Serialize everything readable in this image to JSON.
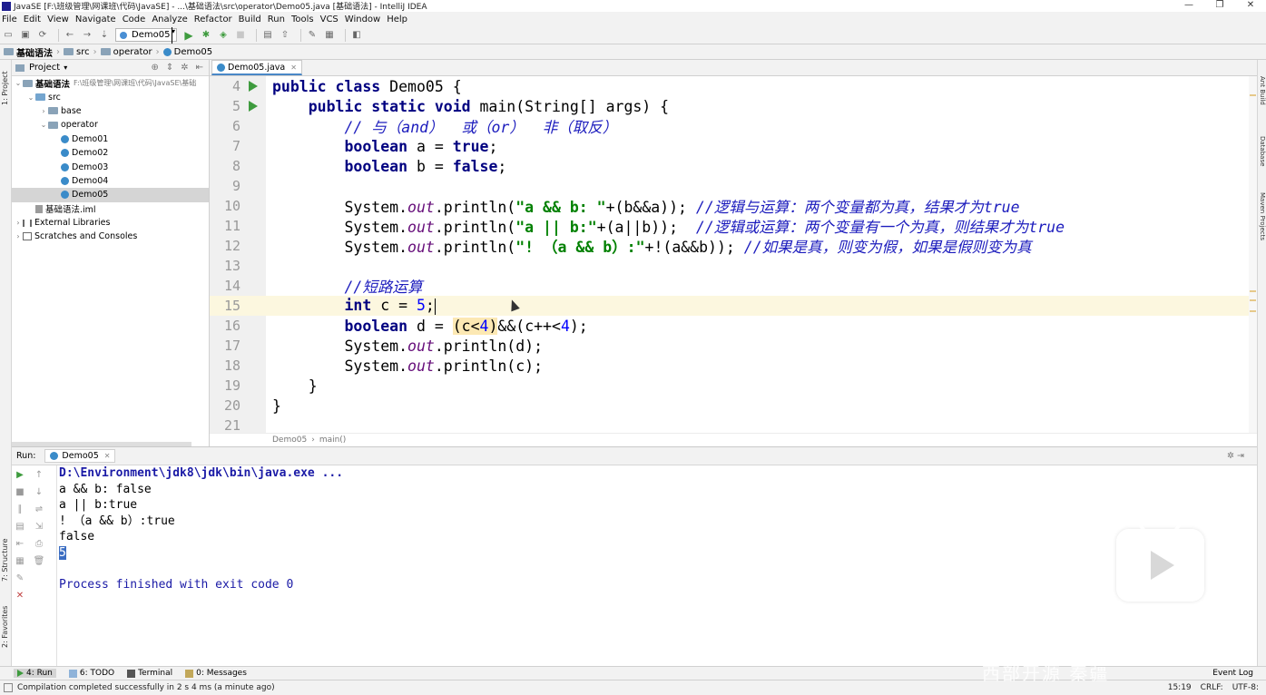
{
  "window": {
    "title": "JavaSE [F:\\班级管理\\网课班\\代码\\JavaSE] - ...\\基础语法\\src\\operator\\Demo05.java [基础语法] - IntelliJ IDEA",
    "minimize": "—",
    "maximize": "❐",
    "close": "✕"
  },
  "menu": [
    "File",
    "Edit",
    "View",
    "Navigate",
    "Code",
    "Analyze",
    "Refactor",
    "Build",
    "Run",
    "Tools",
    "VCS",
    "Window",
    "Help"
  ],
  "toolbar": {
    "run_config": "Demo05"
  },
  "breadcrumb": [
    "基础语法",
    "src",
    "operator",
    "Demo05"
  ],
  "left_strip": {
    "project_label": "1: Project",
    "structure_label": "7: Structure",
    "favorites_label": "2: Favorites"
  },
  "right_strip": {
    "ant_label": "Ant Build",
    "database_label": "Database",
    "maven_label": "Maven Projects"
  },
  "project_panel": {
    "header": "Project",
    "tree": [
      {
        "label": "基础语法",
        "path": "F:\\班级管理\\网课班\\代码\\JavaSE\\基础",
        "indent": 0,
        "arrow": "⌄",
        "icon": "folder"
      },
      {
        "label": "src",
        "indent": 1,
        "arrow": "⌄",
        "icon": "folder-blue"
      },
      {
        "label": "base",
        "indent": 2,
        "arrow": "›",
        "icon": "folder"
      },
      {
        "label": "operator",
        "indent": 2,
        "arrow": "⌄",
        "icon": "folder"
      },
      {
        "label": "Demo01",
        "indent": 3,
        "arrow": "",
        "icon": "class"
      },
      {
        "label": "Demo02",
        "indent": 3,
        "arrow": "",
        "icon": "class"
      },
      {
        "label": "Demo03",
        "indent": 3,
        "arrow": "",
        "icon": "class"
      },
      {
        "label": "Demo04",
        "indent": 3,
        "arrow": "",
        "icon": "class"
      },
      {
        "label": "Demo05",
        "indent": 3,
        "arrow": "",
        "icon": "class",
        "selected": true
      },
      {
        "label": "基础语法.iml",
        "indent": 1,
        "arrow": "",
        "icon": "iml"
      },
      {
        "label": "External Libraries",
        "indent": 0,
        "arrow": "›",
        "icon": "lib"
      },
      {
        "label": "Scratches and Consoles",
        "indent": 0,
        "arrow": "›",
        "icon": "scratch"
      }
    ]
  },
  "editor": {
    "tab": "Demo05.java",
    "footer": [
      "Demo05",
      "main()"
    ],
    "lines": [
      {
        "n": "4",
        "run": true,
        "html": "<span class='kw'>public class</span> Demo05 {"
      },
      {
        "n": "5",
        "run": true,
        "html": "    <span class='kw'>public static void</span> main(String[] args) {"
      },
      {
        "n": "6",
        "html": "        <span class='cmz'>// 与（and）  或（or）  非（取反）</span>"
      },
      {
        "n": "7",
        "html": "        <span class='kw'>boolean</span> a = <span class='kw'>true</span>;"
      },
      {
        "n": "8",
        "html": "        <span class='kw'>boolean</span> b = <span class='kw'>false</span>;"
      },
      {
        "n": "9",
        "html": ""
      },
      {
        "n": "10",
        "html": "        System.<span class='fld'>out</span>.println(<span class='str'>\"a &amp;&amp; b: \"</span>+(b&amp;&amp;a)); <span class='cmz'>//逻辑与运算：两个变量都为真，结果才为true</span>"
      },
      {
        "n": "11",
        "html": "        System.<span class='fld'>out</span>.println(<span class='str'>\"a || b:\"</span>+(a||b));  <span class='cmz'>//逻辑或运算：两个变量有一个为真，则结果才为true</span>"
      },
      {
        "n": "12",
        "html": "        System.<span class='fld'>out</span>.println(<span class='str'>\"! （a &amp;&amp; b）:\"</span>+!(a&amp;&amp;b)); <span class='cmz'>//如果是真，则变为假，如果是假则变为真</span>"
      },
      {
        "n": "13",
        "html": ""
      },
      {
        "n": "14",
        "html": "        <span class='cmz'>//短路运算</span>"
      },
      {
        "n": "15",
        "cur": true,
        "html": "        <span class='kw'>int</span> c = <span class='num'>5</span>;<span class='caret'></span>"
      },
      {
        "n": "16",
        "html": "        <span class='kw'>boolean</span> d = <span class='hl'>(c&lt;<span class='num'>4</span>)</span>&amp;&amp;(c++&lt;<span class='num'>4</span>);"
      },
      {
        "n": "17",
        "html": "        System.<span class='fld'>out</span>.println(d);"
      },
      {
        "n": "18",
        "html": "        System.<span class='fld'>out</span>.println(c);"
      },
      {
        "n": "19",
        "html": "    }"
      },
      {
        "n": "20",
        "html": "}"
      },
      {
        "n": "21",
        "html": ""
      }
    ]
  },
  "run_panel": {
    "label": "Run:",
    "tab": "Demo05",
    "console": [
      {
        "text": "D:\\Environment\\jdk8\\jdk\\bin\\java.exe ...",
        "cls": "path"
      },
      {
        "text": "a && b: false",
        "cls": ""
      },
      {
        "text": "a || b:true",
        "cls": ""
      },
      {
        "text": "! （a && b）:true",
        "cls": ""
      },
      {
        "text": "false",
        "cls": ""
      },
      {
        "text": "5",
        "cls": "sel"
      },
      {
        "text": "",
        "cls": ""
      },
      {
        "text": "Process finished with exit code 0",
        "cls": "proc"
      }
    ]
  },
  "bottom_tabs": {
    "run": "4: Run",
    "todo": "6: TODO",
    "terminal": "Terminal",
    "messages": "0: Messages",
    "event_log": "Event Log"
  },
  "status": {
    "message": "Compilation completed successfully in 2 s 4 ms (a minute ago)",
    "position": "15:19",
    "line_sep": "CRLF:",
    "encoding": "UTF-8:"
  },
  "watermark": "西部开源 秦疆"
}
